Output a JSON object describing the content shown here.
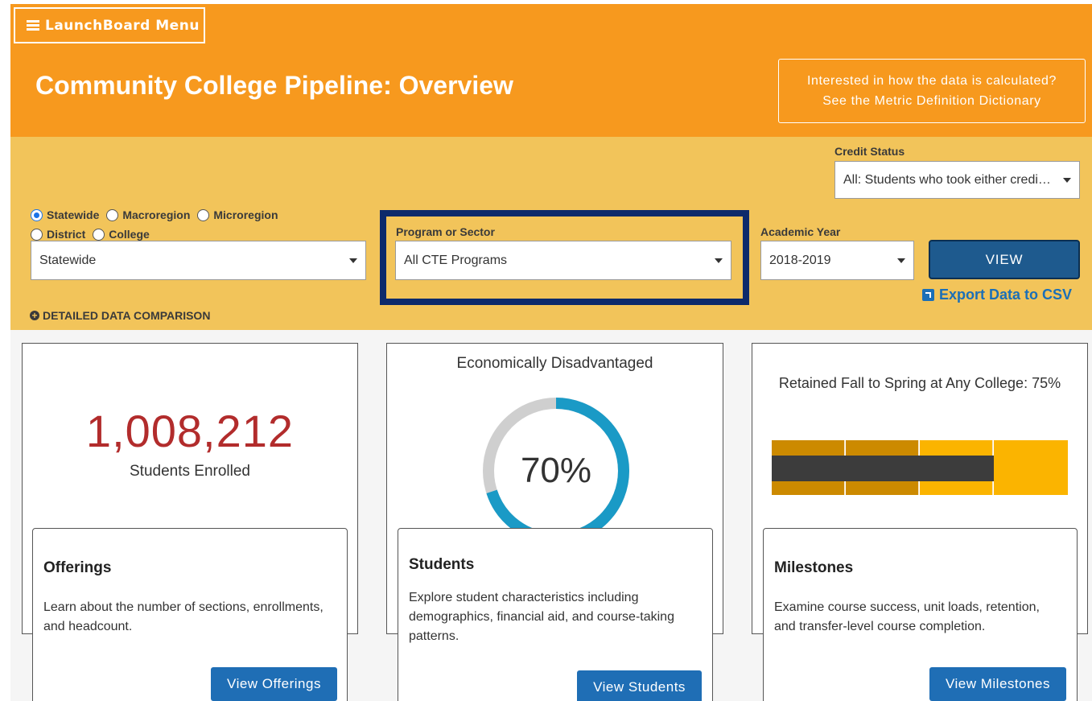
{
  "header": {
    "menu_label": "LaunchBoard Menu",
    "title": "Community College Pipeline: Overview",
    "dictionary_line1": "Interested in how the data is calculated?",
    "dictionary_line2": "See the Metric Definition Dictionary"
  },
  "filters": {
    "credit_status": {
      "label": "Credit Status",
      "value": "All: Students who took either credit or noncredit courses"
    },
    "geography": {
      "options": [
        {
          "label": "Statewide",
          "checked": true
        },
        {
          "label": "Macroregion",
          "checked": false
        },
        {
          "label": "Microregion",
          "checked": false
        },
        {
          "label": "District",
          "checked": false
        },
        {
          "label": "College",
          "checked": false
        }
      ],
      "selected_value": "Statewide"
    },
    "program": {
      "label": "Program or Sector",
      "value": "All CTE Programs"
    },
    "academic_year": {
      "label": "Academic Year",
      "value": "2018-2019"
    },
    "view_button": "VIEW",
    "export_link": "Export Data to CSV",
    "detailed_comparison": "DETAILED DATA COMPARISON"
  },
  "cards": {
    "offerings": {
      "big_number": "1,008,212",
      "caption": "Students Enrolled",
      "heading": "Offerings",
      "description": "Learn about the number of sections, enrollments, and headcount.",
      "button": "View Offerings"
    },
    "students": {
      "chart_title": "Economically Disadvantaged",
      "percent_label": "70%",
      "percent_value": 70,
      "ring_color": "#1a9ac6",
      "ring_track_color": "#cfcfcf",
      "heading": "Students",
      "description": "Explore student characteristics including demographics, financial aid, and course-taking patterns.",
      "button": "View Students"
    },
    "milestones": {
      "chart_title": "Retained Fall to Spring at Any College: 75%",
      "value_percent": 75,
      "band_colors": [
        "#cc8a00",
        "#cc8a00",
        "#fbb400",
        "#fbb400"
      ],
      "bar_color": "#3c3c3c",
      "heading": "Milestones",
      "description": "Examine course success, unit loads, retention, and transfer-level course completion.",
      "button": "View Milestones"
    }
  }
}
